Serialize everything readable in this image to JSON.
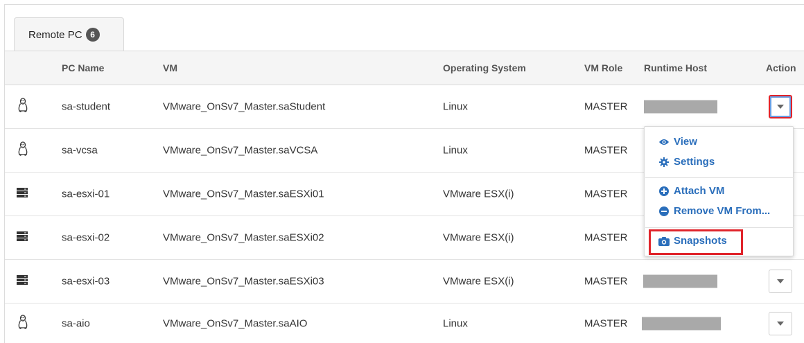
{
  "tab": {
    "label": "Remote PC",
    "count": "6"
  },
  "columns": {
    "pc_name": "PC Name",
    "vm": "VM",
    "os": "Operating System",
    "vm_role": "VM Role",
    "runtime_host": "Runtime Host",
    "action": "Action"
  },
  "rows": [
    {
      "icon": "linux-tux-icon",
      "pc_name": "sa-student",
      "vm": "VMware_OnSv7_Master.saStudent",
      "os": "Linux",
      "vm_role": "MASTER",
      "runtime_host": "",
      "action_open": true
    },
    {
      "icon": "linux-tux-icon",
      "pc_name": "sa-vcsa",
      "vm": "VMware_OnSv7_Master.saVCSA",
      "os": "Linux",
      "vm_role": "MASTER",
      "runtime_host": "",
      "action_open": false
    },
    {
      "icon": "server-icon",
      "pc_name": "sa-esxi-01",
      "vm": "VMware_OnSv7_Master.saESXi01",
      "os": "VMware ESX(i)",
      "vm_role": "MASTER",
      "runtime_host": "",
      "action_open": false
    },
    {
      "icon": "server-icon",
      "pc_name": "sa-esxi-02",
      "vm": "VMware_OnSv7_Master.saESXi02",
      "os": "VMware ESX(i)",
      "vm_role": "MASTER",
      "runtime_host": "",
      "action_open": false
    },
    {
      "icon": "server-icon",
      "pc_name": "sa-esxi-03",
      "vm": "VMware_OnSv7_Master.saESXi03",
      "os": "VMware ESX(i)",
      "vm_role": "MASTER",
      "runtime_host": "",
      "action_open": false
    },
    {
      "icon": "linux-tux-icon",
      "pc_name": "sa-aio",
      "vm": "VMware_OnSv7_Master.saAIO",
      "os": "Linux",
      "vm_role": "MASTER",
      "runtime_host": "",
      "action_open": false
    }
  ],
  "action_menu": {
    "view": "View",
    "settings": "Settings",
    "attach_vm": "Attach VM",
    "remove_vm": "Remove VM From...",
    "snapshots": "Snapshots"
  },
  "colors": {
    "link": "#2a6ebb",
    "highlight": "#e0242b",
    "redacted": "#a9a9a9"
  }
}
